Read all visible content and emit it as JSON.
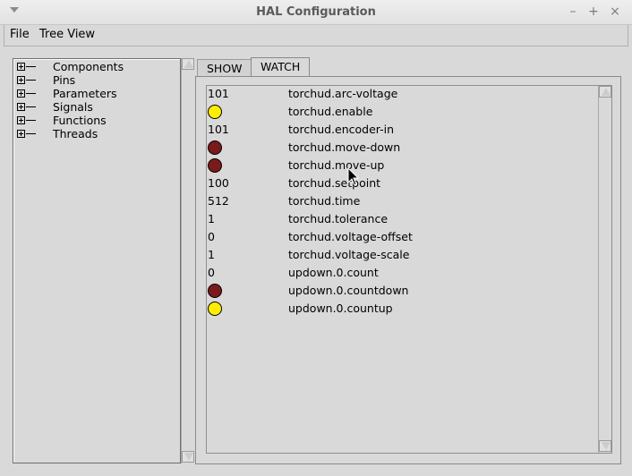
{
  "window": {
    "title": "HAL Configuration",
    "controls": [
      "–",
      "+",
      "×"
    ]
  },
  "menubar": {
    "items": [
      "File",
      "Tree View"
    ]
  },
  "tree": {
    "items": [
      "Components",
      "Pins",
      "Parameters",
      "Signals",
      "Functions",
      "Threads"
    ]
  },
  "tabs": {
    "show_label": "SHOW",
    "watch_label": "WATCH",
    "active": "WATCH"
  },
  "colors": {
    "led_on": "#ffee00",
    "led_off": "#7a1a1a"
  },
  "watch": {
    "rows": [
      {
        "value": "101",
        "name": "torchud.arc-voltage"
      },
      {
        "led": "on",
        "name": "torchud.enable"
      },
      {
        "value": "101",
        "name": "torchud.encoder-in"
      },
      {
        "led": "off",
        "name": "torchud.move-down"
      },
      {
        "led": "off",
        "name": "torchud.move-up"
      },
      {
        "value": "100",
        "name": "torchud.setpoint"
      },
      {
        "value": "512",
        "name": "torchud.time"
      },
      {
        "value": "1",
        "name": "torchud.tolerance"
      },
      {
        "value": "0",
        "name": "torchud.voltage-offset"
      },
      {
        "value": "1",
        "name": "torchud.voltage-scale"
      },
      {
        "value": "0",
        "name": "updown.0.count"
      },
      {
        "led": "off",
        "name": "updown.0.countdown"
      },
      {
        "led": "on",
        "name": "updown.0.countup"
      }
    ]
  }
}
